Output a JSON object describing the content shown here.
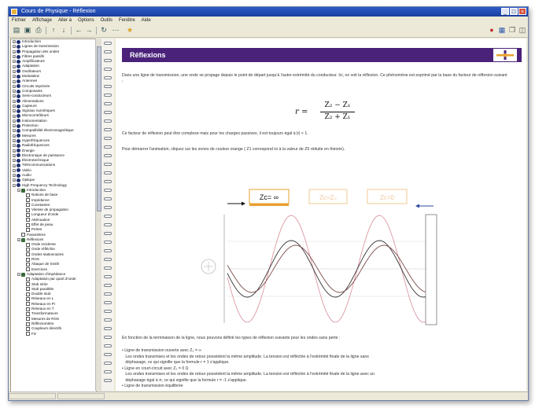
{
  "window": {
    "title": "Cours de Physique - Réflexion",
    "controls": [
      "_",
      "□",
      "×"
    ]
  },
  "menu": [
    "Fichier",
    "Affichage",
    "Aller à",
    "Options",
    "Outils",
    "Fenêtre",
    "Aide"
  ],
  "tree": {
    "items": [
      {
        "label": "Introduction",
        "level": 0,
        "kind": "book"
      },
      {
        "label": "Lignes de transmission",
        "level": 0,
        "kind": "book"
      },
      {
        "label": "Propagation des ondes",
        "level": 0,
        "kind": "book"
      },
      {
        "label": "Filtres passifs",
        "level": 0,
        "kind": "book"
      },
      {
        "label": "Amplificateurs",
        "level": 0,
        "kind": "book"
      },
      {
        "label": "Adaptation",
        "level": 0,
        "kind": "book"
      },
      {
        "label": "Oscillateurs",
        "level": 0,
        "kind": "book"
      },
      {
        "label": "Modulation",
        "level": 0,
        "kind": "book"
      },
      {
        "label": "Antennes",
        "level": 0,
        "kind": "book"
      },
      {
        "label": "Circuits imprimés",
        "level": 0,
        "kind": "book"
      },
      {
        "label": "Composants",
        "level": 0,
        "kind": "book"
      },
      {
        "label": "Semi-conducteurs",
        "level": 0,
        "kind": "book"
      },
      {
        "label": "Alimentations",
        "level": 0,
        "kind": "book"
      },
      {
        "label": "Capteurs",
        "level": 0,
        "kind": "book"
      },
      {
        "label": "Signaux numériques",
        "level": 0,
        "kind": "book"
      },
      {
        "label": "Microcontrôleurs",
        "level": 0,
        "kind": "book"
      },
      {
        "label": "Instrumentation",
        "level": 0,
        "kind": "book"
      },
      {
        "label": "Protection",
        "level": 0,
        "kind": "book"
      },
      {
        "label": "Compatibilité électromagnétique",
        "level": 0,
        "kind": "book"
      },
      {
        "label": "Mesures",
        "level": 0,
        "kind": "book"
      },
      {
        "label": "Hyperfréquences",
        "level": 0,
        "kind": "book"
      },
      {
        "label": "Radiofréquences",
        "level": 0,
        "kind": "book"
      },
      {
        "label": "Énergie",
        "level": 0,
        "kind": "book"
      },
      {
        "label": "Électronique de puissance",
        "level": 0,
        "kind": "book"
      },
      {
        "label": "Électrotechnique",
        "level": 0,
        "kind": "book"
      },
      {
        "label": "Télécommunications",
        "level": 0,
        "kind": "book"
      },
      {
        "label": "Vidéo",
        "level": 0,
        "kind": "book"
      },
      {
        "label": "Audio",
        "level": 0,
        "kind": "book"
      },
      {
        "label": "Optique",
        "level": 0,
        "kind": "book"
      },
      {
        "label": "High Frequency Technology",
        "level": 0,
        "kind": "book",
        "open": true
      },
      {
        "label": "Introduction",
        "level": 1,
        "kind": "book",
        "open": true
      },
      {
        "label": "Notions de base",
        "level": 2,
        "kind": "page"
      },
      {
        "label": "Impédance",
        "level": 2,
        "kind": "page"
      },
      {
        "label": "Constantes",
        "level": 2,
        "kind": "page"
      },
      {
        "label": "Vitesse de propagation",
        "level": 2,
        "kind": "page"
      },
      {
        "label": "Longueur d'onde",
        "level": 2,
        "kind": "page"
      },
      {
        "label": "Atténuation",
        "level": 2,
        "kind": "page"
      },
      {
        "label": "Effet de peau",
        "level": 2,
        "kind": "page"
      },
      {
        "label": "Pertes",
        "level": 2,
        "kind": "page"
      },
      {
        "label": "Paramètres",
        "level": 1,
        "kind": "page"
      },
      {
        "label": "Réflexions",
        "level": 1,
        "kind": "book",
        "open": true
      },
      {
        "label": "Onde incidente",
        "level": 2,
        "kind": "page"
      },
      {
        "label": "Onde réfléchie",
        "level": 2,
        "kind": "page"
      },
      {
        "label": "Ondes stationnaires",
        "level": 2,
        "kind": "page"
      },
      {
        "label": "ROS",
        "level": 2,
        "kind": "page"
      },
      {
        "label": "Abaque de Smith",
        "level": 2,
        "kind": "page"
      },
      {
        "label": "Exercices",
        "level": 2,
        "kind": "page"
      },
      {
        "label": "Adaptation d'impédance",
        "level": 1,
        "kind": "book",
        "open": true
      },
      {
        "label": "Adaptation par quart d'onde",
        "level": 2,
        "kind": "page"
      },
      {
        "label": "Stub série",
        "level": 2,
        "kind": "page"
      },
      {
        "label": "Stub parallèle",
        "level": 2,
        "kind": "page"
      },
      {
        "label": "Double stub",
        "level": 2,
        "kind": "page"
      },
      {
        "label": "Réseaux en L",
        "level": 2,
        "kind": "page"
      },
      {
        "label": "Réseaux en Pi",
        "level": 2,
        "kind": "page"
      },
      {
        "label": "Réseaux en T",
        "level": 2,
        "kind": "page"
      },
      {
        "label": "Transformateurs",
        "level": 2,
        "kind": "page"
      },
      {
        "label": "Mesures de ROS",
        "level": 2,
        "kind": "page"
      },
      {
        "label": "Réflectomètre",
        "level": 2,
        "kind": "page"
      },
      {
        "label": "Coupleurs directifs",
        "level": 2,
        "kind": "page"
      },
      {
        "label": "Fin",
        "level": 2,
        "kind": "page"
      }
    ]
  },
  "content": {
    "heading": "Réflexions",
    "intro": "Dans une ligne de transmission, une onde se propage depuis le point de départ jusqu'à l'autre extrémité du conducteur. Ici, on voit la réflexion. Ce phénomène est exprimé par la base du facteur de réflexion suivant :",
    "formula": {
      "lhs": "r =",
      "numerator": "Z₂ − Z₁",
      "denominator": "Z₂ + Z₁"
    },
    "para2": "Ce facteur de réflexion peut être complexe mais pour les charges passives, il est toujours égal à |r| < 1.",
    "para3": "Pour démarrer l'animation, cliquez sur les zones de couleur orange ( Z1 correspond ici à la valeur de Z0 réduite en théorie).",
    "buttons": [
      {
        "label": "Zc= ∞",
        "active": true
      },
      {
        "label": "Zc=Z₀",
        "active": false
      },
      {
        "label": "Zc=0",
        "active": false
      }
    ],
    "para4": "En fonction de la terminaison de la ligne, nous pouvons définir les types de réflexion suivants pour les ondes sans perte :",
    "bullets": [
      "• Ligne de transmission ouverte avec Z₂ = ∞",
      "   Les ondes transmises et les ondes de retour possèdent la même amplitude. La tension est réfléchie à l'extrémité finale de la ligne sans",
      "   déphasage, ce qui signifie que la formule r = 1 s'applique.",
      "• Ligne en court-circuit avec Z₂ = 0 Ω",
      "   Les ondes transmises et les ondes de retour possèdent la même amplitude. La tension est réfléchie à l'extrémité finale de la ligne avec un",
      "   déphasage égal à π, ce qui signifie que la formule r = -1 s'applique.",
      "• Ligne de transmission équilibrée"
    ]
  },
  "colors": {
    "banner": "#4a227a",
    "accent": "#e8a030",
    "incident": "#c0392b",
    "reflected": "#4f5aa8"
  },
  "icons": {
    "app": "app-icon",
    "logo": "cross-logo-icon",
    "arrow_in": "arrow-right-icon",
    "arrow_out": "arrow-left-icon"
  }
}
